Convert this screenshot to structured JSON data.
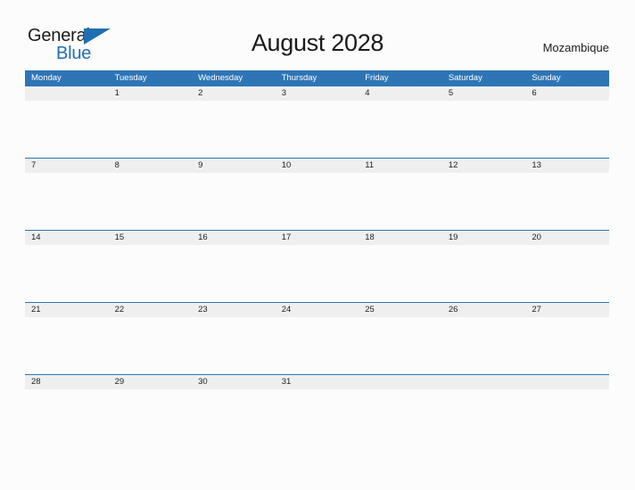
{
  "logo": {
    "word_one": "General",
    "word_two": "Blue",
    "triangle_icon": "triangle-flag-icon",
    "accent_color": "#1f6fb2"
  },
  "header": {
    "title": "August 2028",
    "country": "Mozambique"
  },
  "theme": {
    "header_blue": "#2e75b6",
    "row_divider_blue": "#2e75b6",
    "date_strip_gray": "#efefef",
    "page_background": "#fcfcfc",
    "text_color": "#1a1a1a"
  },
  "calendar": {
    "month": "August",
    "year": "2028",
    "weekdays": [
      "Monday",
      "Tuesday",
      "Wednesday",
      "Thursday",
      "Friday",
      "Saturday",
      "Sunday"
    ],
    "weeks": [
      [
        "",
        "1",
        "2",
        "3",
        "4",
        "5",
        "6"
      ],
      [
        "7",
        "8",
        "9",
        "10",
        "11",
        "12",
        "13"
      ],
      [
        "14",
        "15",
        "16",
        "17",
        "18",
        "19",
        "20"
      ],
      [
        "21",
        "22",
        "23",
        "24",
        "25",
        "26",
        "27"
      ],
      [
        "28",
        "29",
        "30",
        "31",
        "",
        "",
        ""
      ]
    ]
  }
}
